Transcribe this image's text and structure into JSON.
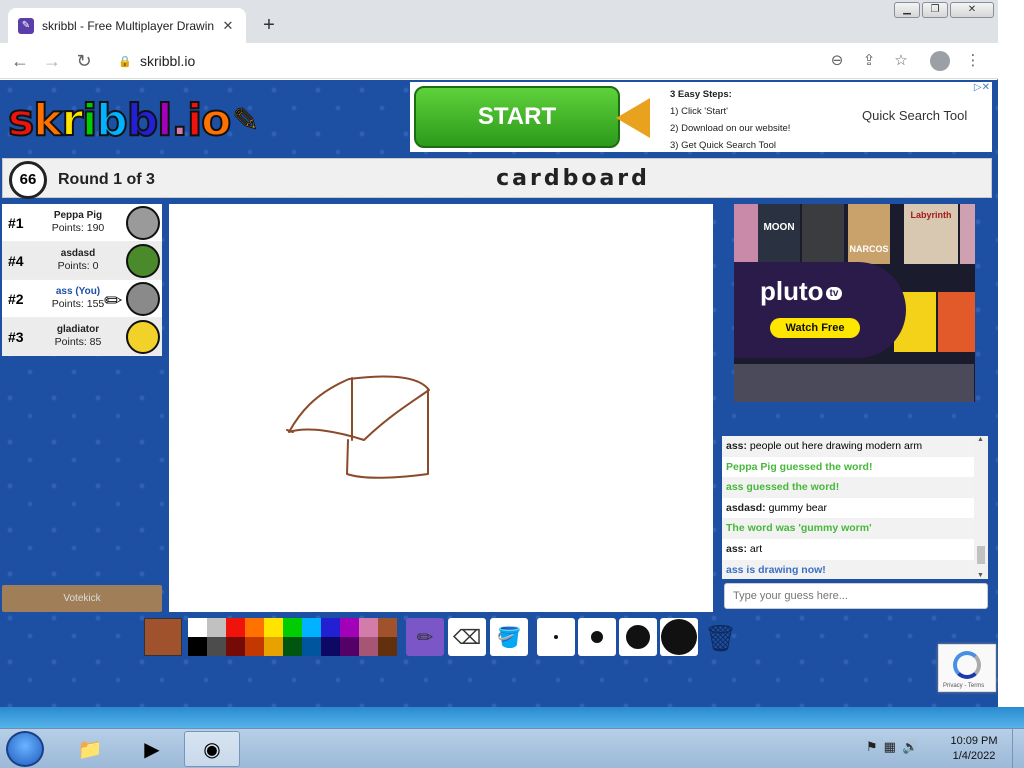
{
  "browser": {
    "tab_title": "skribbl - Free Multiplayer Drawin",
    "url": "skribbl.io"
  },
  "page": {
    "logo_text": "skribbl.io"
  },
  "ad_top": {
    "start_label": "START",
    "steps_title": "3 Easy Steps:",
    "steps": [
      "1) Click 'Start'",
      "2) Download on our website!",
      "3) Get Quick Search Tool"
    ],
    "brand": "Quick Search Tool"
  },
  "game": {
    "timer": "66",
    "round": "Round 1 of 3",
    "word": "cardboard"
  },
  "players": [
    {
      "rank": "#1",
      "name": "Peppa Pig",
      "points": "Points: 190",
      "avatar_color": "#9a9a9a",
      "you": false
    },
    {
      "rank": "#4",
      "name": "asdasd",
      "points": "Points: 0",
      "avatar_color": "#4a8a2a",
      "you": false
    },
    {
      "rank": "#2",
      "name": "ass (You)",
      "points": "Points: 155",
      "avatar_color": "#8a8a8a",
      "you": true
    },
    {
      "rank": "#3",
      "name": "gladiator",
      "points": "Points: 85",
      "avatar_color": "#f2d22a",
      "you": false
    }
  ],
  "votekick_label": "Votekick",
  "side_ad": {
    "brand": "pluto",
    "brand_tv": "tv",
    "cta": "Watch Free",
    "moon": "MOON",
    "narcos": "NARCOS",
    "labyrinth": "Labyrinth"
  },
  "chat": {
    "messages": [
      {
        "who": "ass:",
        "text": " people out here drawing modern arm",
        "style": "normal"
      },
      {
        "who": "",
        "text": "Peppa Pig guessed the word!",
        "style": "green"
      },
      {
        "who": "",
        "text": "ass guessed the word!",
        "style": "green"
      },
      {
        "who": "asdasd:",
        "text": " gummy bear",
        "style": "normal"
      },
      {
        "who": "",
        "text": "The word was 'gummy worm'",
        "style": "green"
      },
      {
        "who": "ass:",
        "text": " art",
        "style": "normal"
      },
      {
        "who": "",
        "text": "ass is drawing now!",
        "style": "blue"
      }
    ],
    "input_placeholder": "Type your guess here..."
  },
  "palette": {
    "current_color": "#a0522d",
    "colors_top": [
      "#ffffff",
      "#c1c1c1",
      "#ef130b",
      "#ff7100",
      "#ffe400",
      "#00cc00",
      "#00b2ff",
      "#231fd3",
      "#a300ba",
      "#d37caa",
      "#a0522d"
    ],
    "colors_bottom": [
      "#000000",
      "#4c4c4c",
      "#740b07",
      "#c23800",
      "#e8a200",
      "#005510",
      "#00569e",
      "#0e0865",
      "#550069",
      "#a75574",
      "#63300d"
    ]
  },
  "recaptcha_text": "Privacy - Terms",
  "taskbar": {
    "time": "10:09 PM",
    "date": "1/4/2022"
  }
}
